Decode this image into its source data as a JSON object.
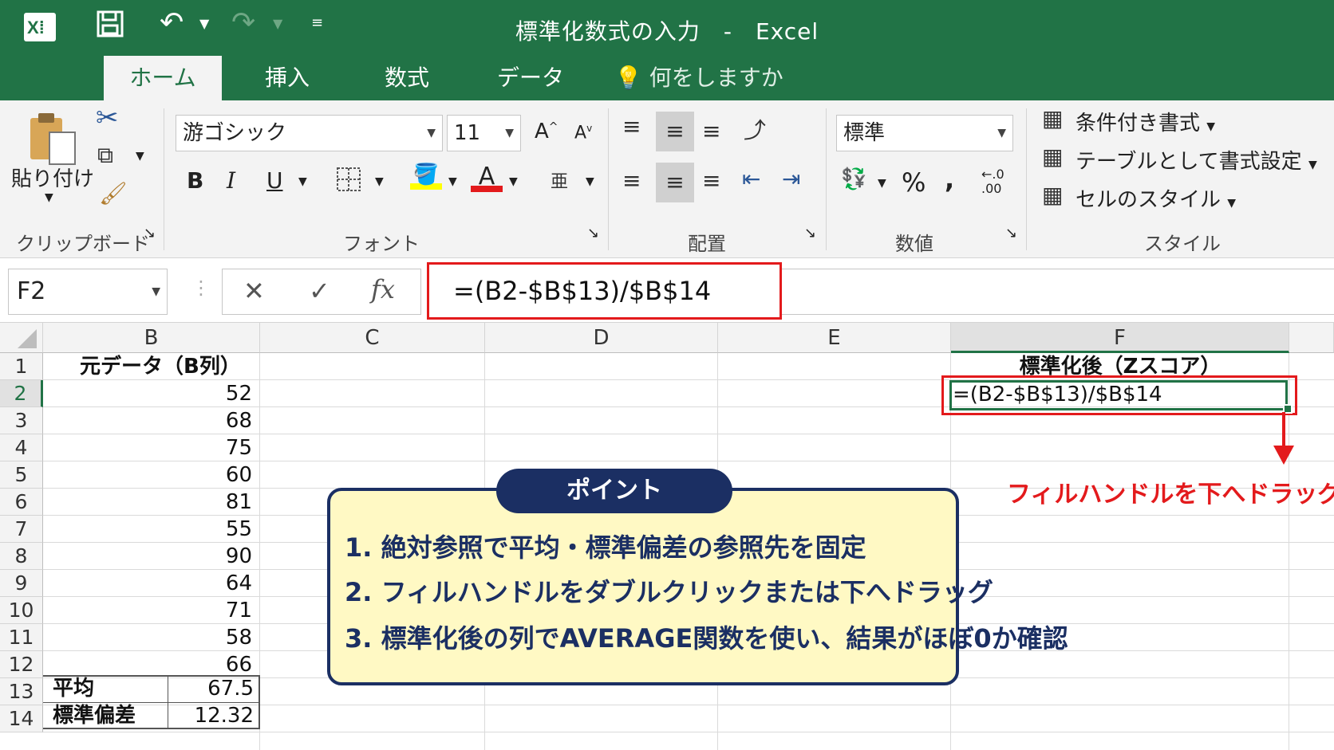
{
  "window": {
    "title": "標準化数式の入力　-　Excel",
    "app_icon": "excel-icon"
  },
  "tabs": [
    {
      "label": "ホーム",
      "active": true
    },
    {
      "label": "挿入",
      "active": false
    },
    {
      "label": "数式",
      "active": false
    },
    {
      "label": "データ",
      "active": false
    }
  ],
  "tell_me": "何をしますか",
  "ribbon": {
    "clipboard": {
      "paste": "貼り付け",
      "label": "クリップボード"
    },
    "font": {
      "name": "游ゴシック",
      "size": "11",
      "label": "フォント",
      "bold": "B",
      "italic": "I",
      "underline": "U",
      "grow": "A",
      "shrink": "A",
      "color_a": "A"
    },
    "alignment": {
      "label": "配置"
    },
    "number": {
      "format": "標準",
      "percent": "%",
      "comma": ",",
      "decimal": "←.0\n.00",
      "label": "数値"
    },
    "styles": {
      "conditional": "条件付き書式",
      "table": "テーブルとして書式設定",
      "cell": "セルのスタイル",
      "label": "スタイル"
    }
  },
  "formula_bar": {
    "name_box": "F2",
    "formula": "=(B2-$B$13)/$B$14",
    "cancel": "✕",
    "enter": "✓",
    "fx": "fx"
  },
  "columns": [
    "B",
    "C",
    "D",
    "E",
    "F"
  ],
  "rows": [
    "1",
    "2",
    "3",
    "4",
    "5",
    "6",
    "7",
    "8",
    "9",
    "10",
    "11",
    "12",
    "13",
    "14"
  ],
  "sheet": {
    "b1": "元データ（B列）",
    "values": [
      "52",
      "68",
      "75",
      "60",
      "81",
      "55",
      "90",
      "64",
      "71",
      "58",
      "66"
    ],
    "mean_label": "平均",
    "mean_value": "67.5",
    "sd_label": "標準偏差",
    "sd_value": "12.32",
    "f1": "標準化後（Zスコア）",
    "f2": "=(B2-$B$13)/$B$14"
  },
  "annotation": {
    "drag_hint": "フィルハンドルを下へドラッグ",
    "color": "#e31a1c"
  },
  "point": {
    "title": "ポイント",
    "items": [
      "1.  絶対参照で平均・標準偏差の参照先を固定",
      "2.  フィルハンドルをダブルクリックまたは下へドラッグ",
      "3.  標準化後の列でAVERAGE関数を使い、結果がほぼ0か確認"
    ]
  }
}
